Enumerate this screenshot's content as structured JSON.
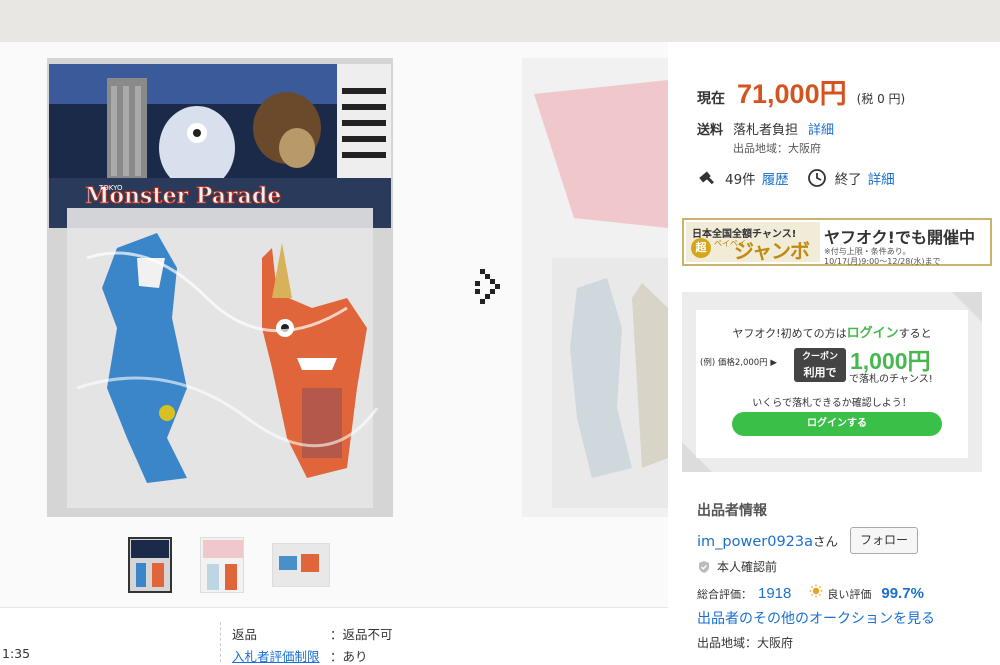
{
  "price": {
    "label": "現在",
    "value": "71,000円",
    "tax": "(税 0 円)"
  },
  "shipping": {
    "label": "送料",
    "value": "落札者負担",
    "link": "詳細",
    "region": "出品地域：大阪府"
  },
  "bids": {
    "count": "49件",
    "history_link": "履歴",
    "status": "終了",
    "detail_link": "詳細"
  },
  "banner": {
    "top": "日本全国全額チャンス!",
    "super": "超",
    "paypay": "ペイペイ",
    "jumbo": "ジャンボ",
    "right": "ヤフオク!でも開催中",
    "note1": "※付与上限・条件あり。",
    "note2": "10/17(月)9:00〜12/28(水)まで"
  },
  "login_promo": {
    "line1_pre": "ヤフオク!初めての方は",
    "line1_login": "ログイン",
    "line1_post": "すると",
    "example": "(例) 価格2,000円 ▶",
    "coupon_top": "クーポン",
    "coupon_bottom": "利用で",
    "amount": "1,000円",
    "sub": "で落札のチャンス!",
    "check": "いくらで落札できるか確認しよう！",
    "button": "ログインする"
  },
  "seller": {
    "heading": "出品者情報",
    "name": "im_power0923a",
    "honorific": "さん",
    "follow": "フォロー",
    "verified": "本人確認前",
    "total_label": "総合評価：",
    "total": "1918",
    "good_label": "良い評価",
    "good_pct": "99.7%",
    "other_link": "出品者のその他のオークションを見る",
    "region": "出品地域：大阪府"
  },
  "product": {
    "package_title": "Monster Parade",
    "tokyo": "TOKYO"
  },
  "details": {
    "time_fragment": "1:35",
    "return_label": "返品",
    "return_value": "：返品不可",
    "rating_label": "入札者評価制限",
    "rating_value": "：あり"
  },
  "colors": {
    "price": "#d4531e",
    "link": "#1a6fd0",
    "green": "#3ac048"
  }
}
